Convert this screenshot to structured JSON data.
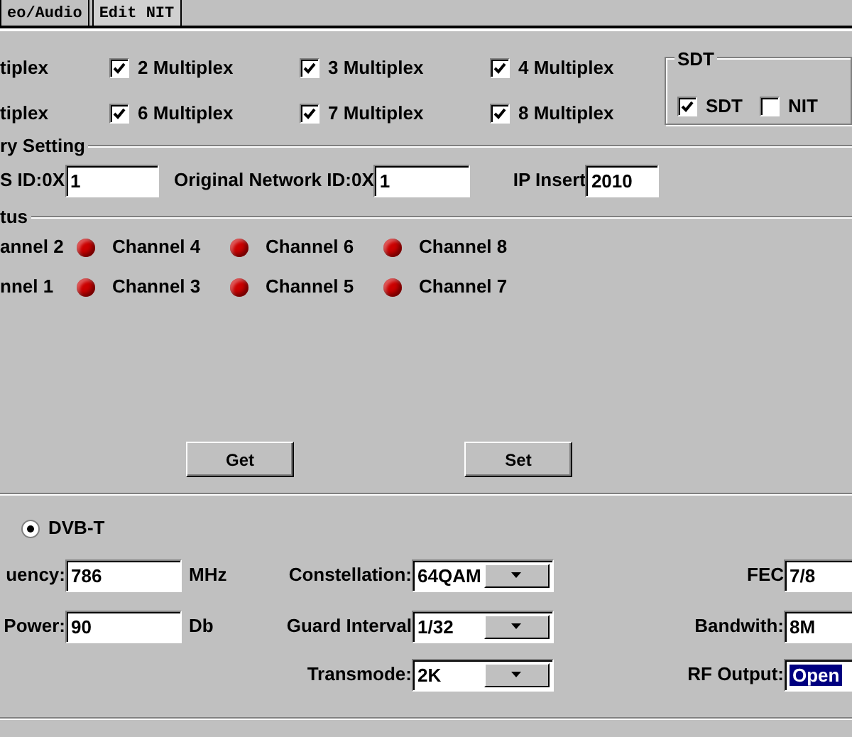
{
  "tabs": [
    {
      "label": "eo/Audio",
      "selected": false
    },
    {
      "label": "Edit NIT",
      "selected": true
    }
  ],
  "multiplex_rows": [
    [
      {
        "kind": "cut",
        "label": "tiplex"
      },
      {
        "kind": "checkbox",
        "label": "2 Multiplex",
        "checked": true
      },
      {
        "kind": "checkbox",
        "label": "3 Multiplex",
        "checked": true
      },
      {
        "kind": "checkbox",
        "label": "4 Multiplex",
        "checked": true
      }
    ],
    [
      {
        "kind": "cut",
        "label": "tiplex"
      },
      {
        "kind": "checkbox",
        "label": "6 Multiplex",
        "checked": true
      },
      {
        "kind": "checkbox",
        "label": "7 Multiplex",
        "checked": true
      },
      {
        "kind": "checkbox",
        "label": "8 Multiplex",
        "checked": true
      }
    ]
  ],
  "sdt": {
    "title": "SDT",
    "options": [
      {
        "label": "SDT",
        "checked": true
      },
      {
        "label": "NIT",
        "checked": false
      }
    ]
  },
  "setting": {
    "title": "ry Setting",
    "fields": [
      {
        "label": "S ID:0X",
        "value": "1"
      },
      {
        "label": "Original Network ID:0X",
        "value": "1"
      },
      {
        "label": "IP Insert",
        "value": "2010"
      }
    ]
  },
  "status": {
    "title": "tus",
    "rows": [
      [
        {
          "label": "annel 2"
        },
        {
          "label": "Channel 4",
          "color": "#cc0000"
        },
        {
          "label": "Channel 6",
          "color": "#cc0000"
        },
        {
          "label": "Channel 8",
          "color": "#cc0000"
        }
      ],
      [
        {
          "label": "nnel 1"
        },
        {
          "label": "Channel 3",
          "color": "#cc0000"
        },
        {
          "label": "Channel 5",
          "color": "#cc0000"
        },
        {
          "label": "Channel 7",
          "color": "#cc0000"
        }
      ]
    ]
  },
  "buttons": [
    "Get",
    "Set"
  ],
  "mode": {
    "label": "DVB-T",
    "selected": true
  },
  "left_fields": [
    {
      "label": "uency:",
      "value": "786",
      "unit": "MHz"
    },
    {
      "label": "Power:",
      "value": "90",
      "unit": "Db"
    }
  ],
  "dropdowns": [
    {
      "label": "Constellation:",
      "value": "64QAM"
    },
    {
      "label": "Guard Interval",
      "value": "1/32"
    },
    {
      "label": "Transmode:",
      "value": "2K"
    }
  ],
  "right_fields": [
    {
      "label": "FEC",
      "value": "7/8",
      "selected": false
    },
    {
      "label": "Bandwith:",
      "value": "8M",
      "selected": false
    },
    {
      "label": "RF Output:",
      "value": "Open",
      "selected": true
    }
  ]
}
